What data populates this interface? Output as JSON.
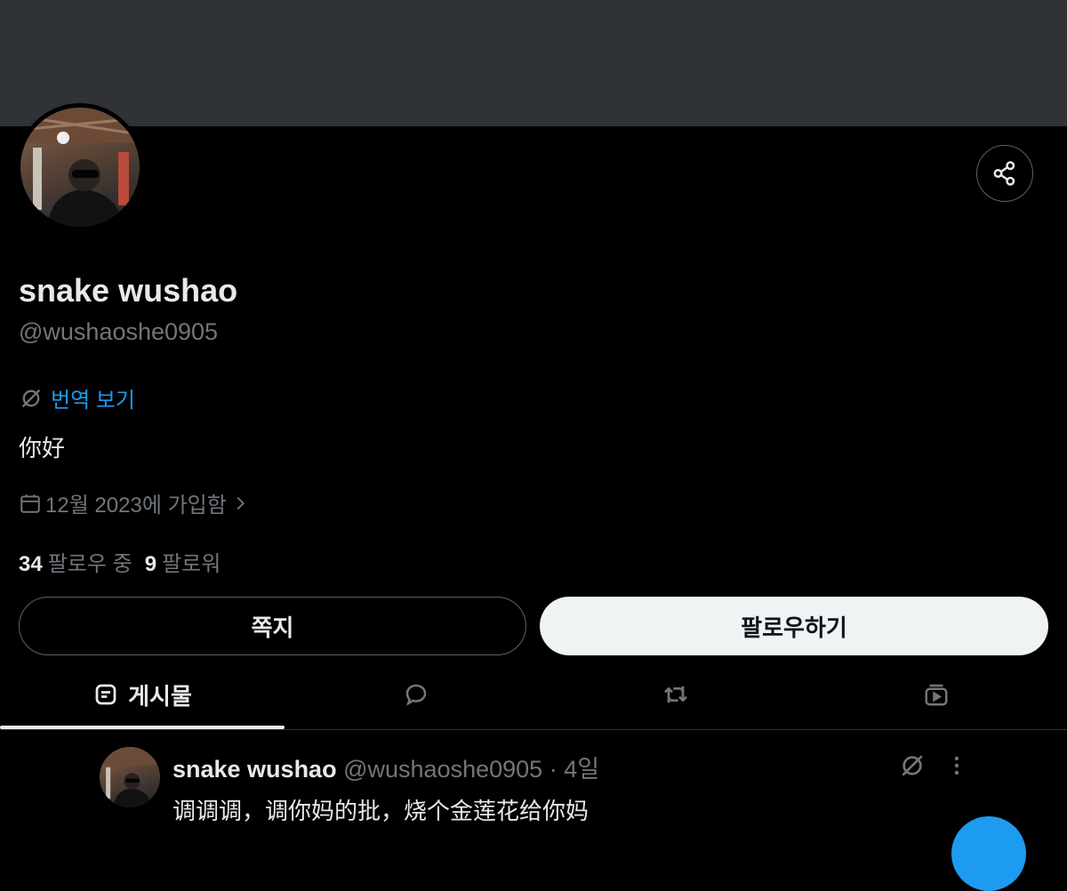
{
  "profile": {
    "display_name": "snake wushao",
    "handle": "@wushaoshe0905",
    "translate_label": "번역 보기",
    "bio": "你好",
    "joined": "12월 2023에 가입함",
    "following_count": "34",
    "following_label": "팔로우 중",
    "followers_count": "9",
    "followers_label": "팔로워"
  },
  "actions": {
    "message_label": "쪽지",
    "follow_label": "팔로우하기"
  },
  "tabs": [
    {
      "label": "게시물",
      "icon": "posts-icon",
      "selected": true
    },
    {
      "label": "",
      "icon": "replies-icon"
    },
    {
      "label": "",
      "icon": "reposts-icon"
    },
    {
      "label": "",
      "icon": "media-icon"
    }
  ],
  "post": {
    "author_name": "snake wushao",
    "author_handle": "@wushaoshe0905",
    "separator": "·",
    "time": "4일",
    "text": "调调调，调你妈的批，烧个金莲花给你妈"
  },
  "colors": {
    "background": "#000000",
    "banner": "#2f3336",
    "accent": "#1d9bf0",
    "primary_text": "#e7e9ea",
    "secondary_text": "#71767b"
  }
}
